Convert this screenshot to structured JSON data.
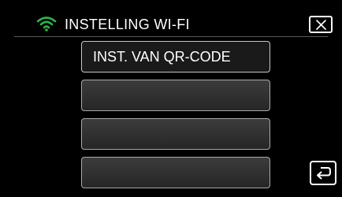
{
  "header": {
    "title": "INSTELLING WI-FI",
    "wifi_icon": "wifi-icon",
    "close_icon": "close-icon"
  },
  "menu": {
    "items": [
      {
        "label": "INST. VAN QR-CODE"
      },
      {
        "label": ""
      },
      {
        "label": ""
      },
      {
        "label": ""
      }
    ]
  },
  "footer": {
    "back_icon": "back-arrow-icon"
  },
  "colors": {
    "background": "#000000",
    "text": "#ffffff",
    "wifi_accent": "#2db34a",
    "button_border": "#aaaaaa"
  }
}
